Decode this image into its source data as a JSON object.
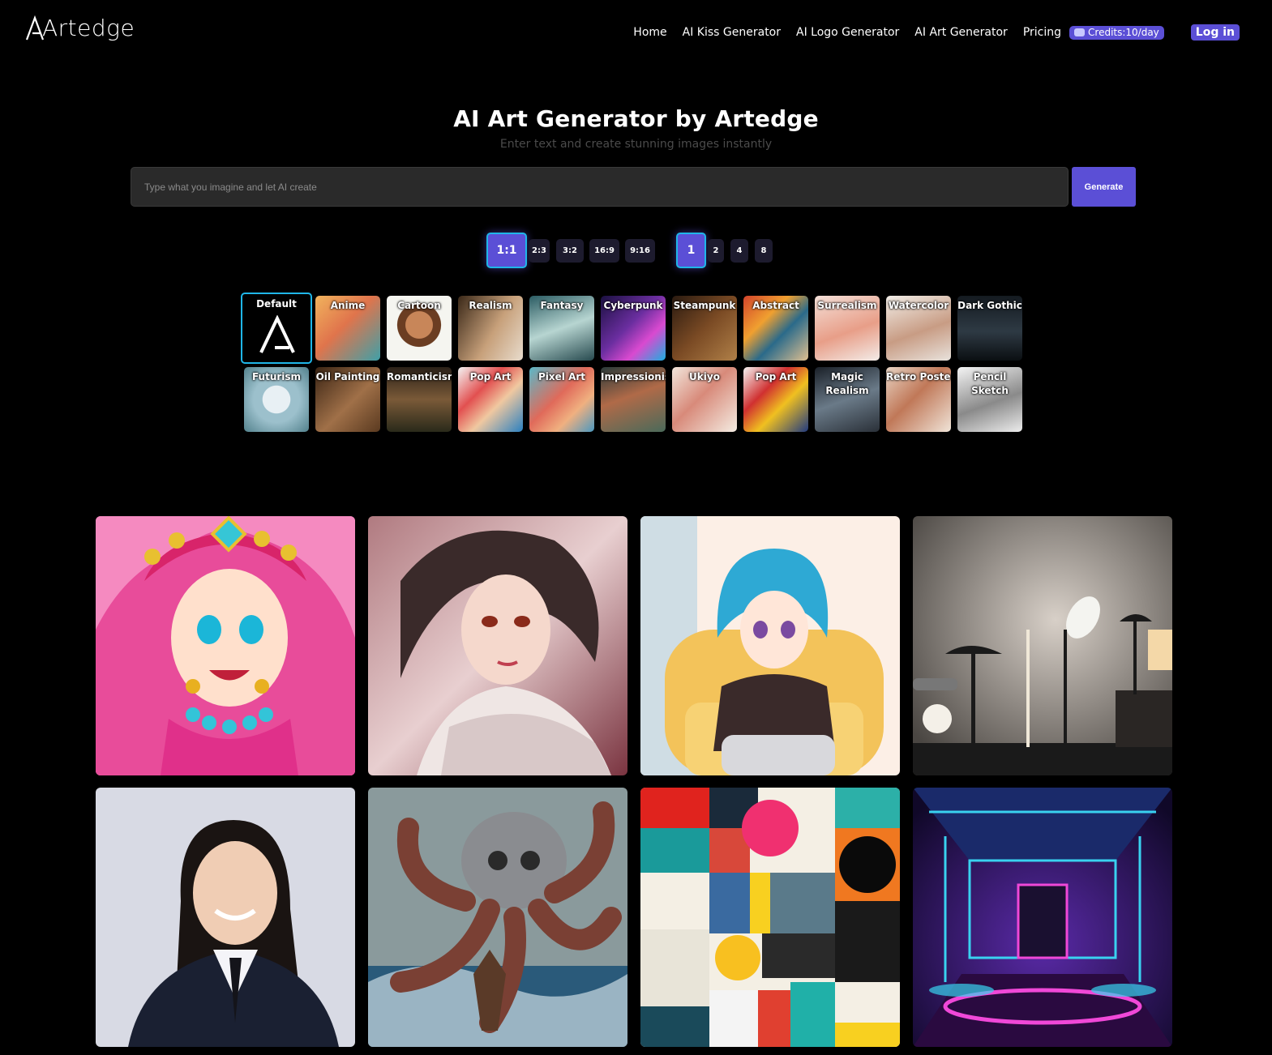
{
  "brand": {
    "name": "Artedge",
    "accent": "#5b4fd6",
    "highlight": "#1fb6e8"
  },
  "nav": {
    "items": [
      "Home",
      "AI Kiss Generator",
      "AI Logo Generator",
      "AI Art Generator",
      "Pricing"
    ],
    "credits": "Credits:10/day",
    "login": "Log in"
  },
  "hero": {
    "title": "AI Art Generator by Artedge",
    "subtitle": "Enter text and create stunning images instantly"
  },
  "prompt": {
    "placeholder": "Type what you imagine and let AI create",
    "button": "Generate"
  },
  "aspect_ratios": {
    "options": [
      "1:1",
      "2:3",
      "3:2",
      "16:9",
      "9:16"
    ],
    "selected": "1:1"
  },
  "image_counts": {
    "options": [
      "1",
      "2",
      "4",
      "8"
    ],
    "selected": "1"
  },
  "styles": {
    "row1": [
      "Default",
      "Anime",
      "Cartoon",
      "Realism",
      "Fantasy",
      "Cyberpunk",
      "Steampunk",
      "Abstract",
      "Surrealism",
      "Watercolor",
      "Dark Gothic"
    ],
    "row2": [
      "Futurism",
      "Oil Painting",
      "Romanticism",
      "Pop Art",
      "Pixel Art",
      "Impressionism",
      "Ukiyo",
      "Pop Art",
      "Magic Realism",
      "Retro Poster",
      "Pencil Sketch"
    ],
    "selected": "Default"
  },
  "gallery": [
    "anime-girl-pink-hat",
    "fantasy-woman-portrait",
    "anime-girl-armchair",
    "desk-lamps-interior",
    "business-portrait",
    "octopus-warrior",
    "abstract-collage",
    "cyberpunk-neon-room"
  ]
}
